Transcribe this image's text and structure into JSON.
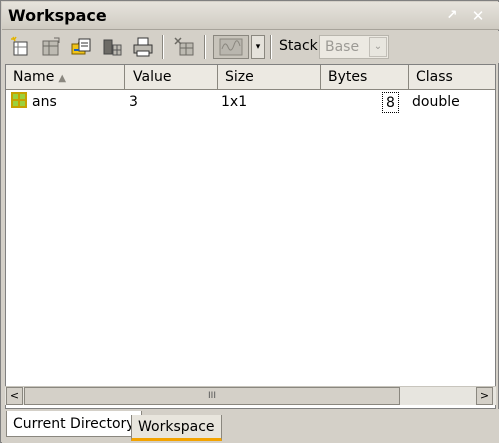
{
  "window": {
    "title": "Workspace",
    "undock_glyph": "↗",
    "close_glyph": "✕"
  },
  "toolbar": {
    "icons": [
      "new-variable-icon",
      "open-selection-icon",
      "import-data-icon",
      "save-icon",
      "print-icon",
      "delete-icon"
    ],
    "plot_dropdown_glyph": "▾",
    "stack_label": "Stack:",
    "stack_value": "Base",
    "stack_arrow_glyph": "⌄"
  },
  "table": {
    "columns": [
      "Name",
      "Value",
      "Size",
      "Bytes",
      "Class"
    ],
    "sort_glyph": "▲",
    "rows": [
      {
        "name": "ans",
        "value": "3",
        "size": "1x1",
        "bytes": "8",
        "class": "double"
      }
    ]
  },
  "scrollbar": {
    "left_glyph": "<",
    "right_glyph": ">",
    "grip_glyph": "III"
  },
  "tabs": {
    "current_directory": "Current Directory",
    "workspace": "Workspace",
    "active": "Workspace"
  },
  "colors": {
    "active_tab_accent": "#f3a300",
    "panel_bg": "#d4d0c8"
  }
}
